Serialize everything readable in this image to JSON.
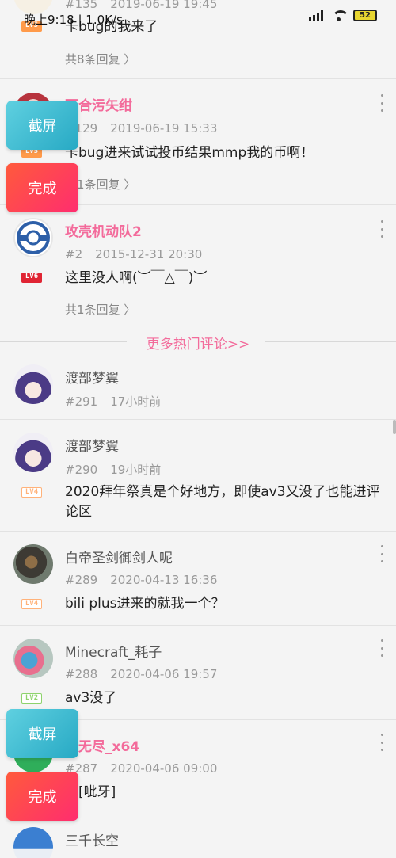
{
  "status_bar": {
    "time": "晚上9:18 | 1.0K/s",
    "battery": "52"
  },
  "comments": [
    {
      "id": "c135",
      "floor": "#135",
      "datetime": "2019-06-19 19:45",
      "level": "LV5",
      "text": "卡bug的我来了",
      "replies": "共8条回复 〉"
    },
    {
      "id": "c129",
      "username": "百合污矢绀",
      "floor": "#129",
      "datetime": "2019-06-19 15:33",
      "level": "LV5",
      "text": "卡bug进来试试投币结果mmp我的币啊！",
      "replies": "共1条回复 〉"
    },
    {
      "id": "c2",
      "username": "攻壳机动队2",
      "floor": "#2",
      "datetime": "2015-12-31 20:30",
      "level": "LV6",
      "text": "这里没人啊(︶￣△￣)︶",
      "replies": "共1条回复 〉"
    },
    {
      "id": "c291",
      "username": "渡部梦翼",
      "floor": "#291",
      "datetime": "17小时前"
    },
    {
      "id": "c290",
      "username": "渡部梦翼",
      "floor": "#290",
      "datetime": "19小时前",
      "level": "LV4",
      "text": "2020拜年祭真是个好地方，即使av3又没了也能进评论区"
    },
    {
      "id": "c289",
      "username": "白帝圣剑御剑人呢",
      "floor": "#289",
      "datetime": "2020-04-13 16:36",
      "level": "LV4",
      "text": "bili plus进来的就我一个？"
    },
    {
      "id": "c288",
      "username": "Minecraft_耗子",
      "floor": "#288",
      "datetime": "2020-04-06 19:57",
      "level": "LV2",
      "text": "av3没了"
    },
    {
      "id": "c287",
      "username": "云无尽_x64",
      "floor": "#287",
      "datetime": "2020-04-06 09:00",
      "text": "古[呲牙]"
    },
    {
      "id": "c286",
      "username": "三千长空"
    }
  ],
  "more_hot": "更多热门评论>>",
  "buttons": {
    "screenshot": "截屏",
    "done": "完成"
  },
  "colors": {
    "accent_pink": "#f36b9b",
    "screenshot_btn": "#3fb8d0",
    "done_btn": "#ff3c5a"
  }
}
